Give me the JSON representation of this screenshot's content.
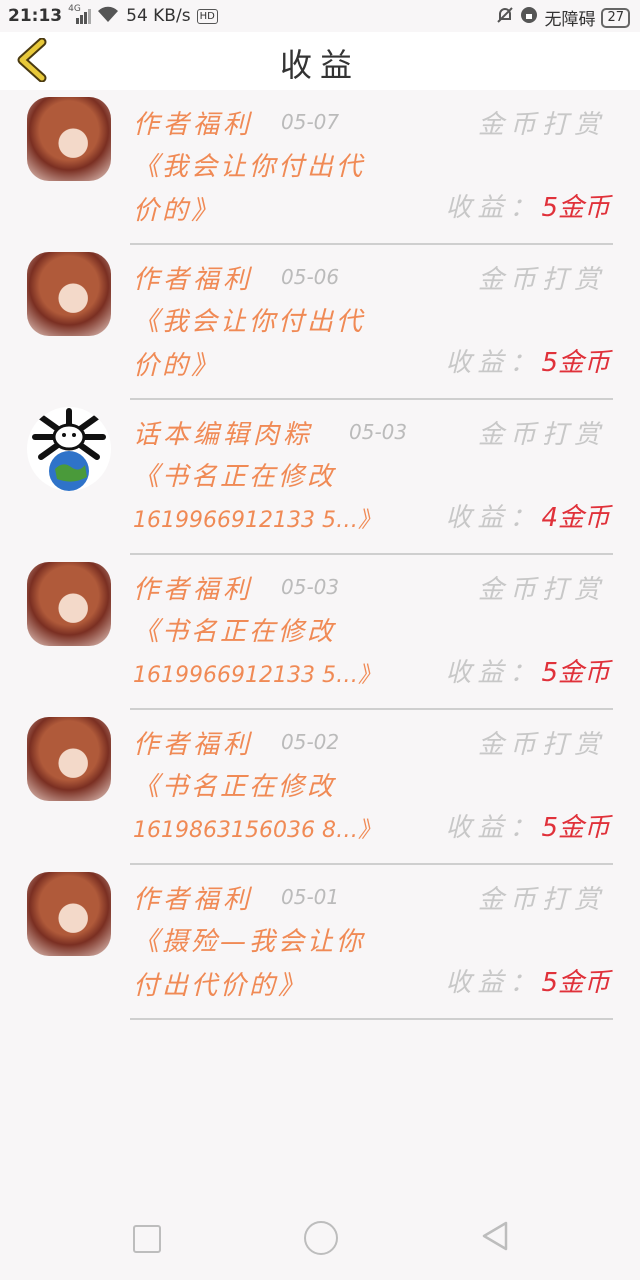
{
  "status_bar": {
    "time": "21:13",
    "network": "4G",
    "speed": "54 KB/s",
    "hd": "HD",
    "accessibility": "无障碍",
    "battery": "27"
  },
  "header": {
    "title": "收益"
  },
  "items": [
    {
      "author": "作者福利",
      "date": "05-07",
      "type": "金币打赏",
      "book_line1": "《我会让你付出代",
      "book_line2": "价的》",
      "income_label": "收益：",
      "income_value": "5金币"
    },
    {
      "author": "作者福利",
      "date": "05-06",
      "type": "金币打赏",
      "book_line1": "《我会让你付出代",
      "book_line2": "价的》",
      "income_label": "收益：",
      "income_value": "5金币"
    },
    {
      "author": "话本编辑肉粽",
      "date": "05-03",
      "type": "金币打赏",
      "book_line1": "《书名正在修改",
      "book_line2": "1619966912133 5…》",
      "income_label": "收益：",
      "income_value": "4金币"
    },
    {
      "author": "作者福利",
      "date": "05-03",
      "type": "金币打赏",
      "book_line1": "《书名正在修改",
      "book_line2": "1619966912133 5…》",
      "income_label": "收益：",
      "income_value": "5金币"
    },
    {
      "author": "作者福利",
      "date": "05-02",
      "type": "金币打赏",
      "book_line1": "《书名正在修改",
      "book_line2": "1619863156036 8…》",
      "income_label": "收益：",
      "income_value": "5金币"
    },
    {
      "author": "作者福利",
      "date": "05-01",
      "type": "金币打赏",
      "book_line1": "《摄殓—我会让你",
      "book_line2": "付出代价的》",
      "income_label": "收益：",
      "income_value": "5金币"
    }
  ],
  "colors": {
    "accent": "#f08a55",
    "income": "#e0313a",
    "muted": "#c8c8c8",
    "back_arrow": "#e8c93a"
  }
}
